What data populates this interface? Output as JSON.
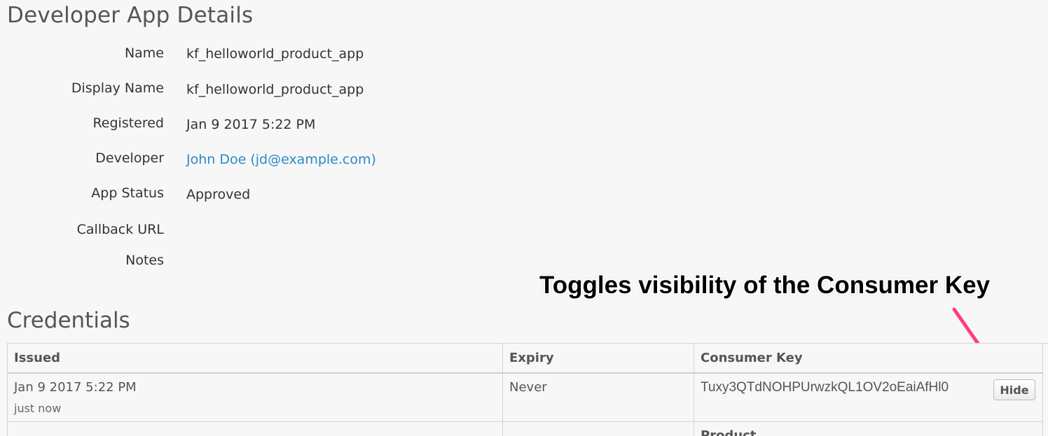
{
  "page": {
    "title": "Developer App Details"
  },
  "details": {
    "name_label": "Name",
    "name_value": "kf_helloworld_product_app",
    "display_name_label": "Display Name",
    "display_name_value": "kf_helloworld_product_app",
    "registered_label": "Registered",
    "registered_value": "Jan 9 2017 5:22 PM",
    "developer_label": "Developer",
    "developer_value": "John Doe (jd@example.com)",
    "app_status_label": "App Status",
    "app_status_value": "Approved",
    "callback_url_label": "Callback URL",
    "callback_url_value": "",
    "notes_label": "Notes",
    "notes_value": ""
  },
  "annotation": {
    "text": "Toggles visibility of the Consumer Key",
    "arrow_color": "#ff3d7f"
  },
  "credentials": {
    "title": "Credentials",
    "columns": {
      "issued": "Issued",
      "expiry": "Expiry",
      "consumer_key": "Consumer Key"
    },
    "rows": [
      {
        "issued": "Jan 9 2017 5:22 PM",
        "issued_relative": "just now",
        "expiry": "Never",
        "consumer_key": "Tuxy3QTdNOHPUrwzkQL1OV2oEaiAfHl0",
        "toggle_label": "Hide"
      }
    ],
    "product_header": "Product"
  },
  "colors": {
    "background": "#f7f7f7",
    "link": "#2a8bc7",
    "border": "#d4d4d4"
  }
}
